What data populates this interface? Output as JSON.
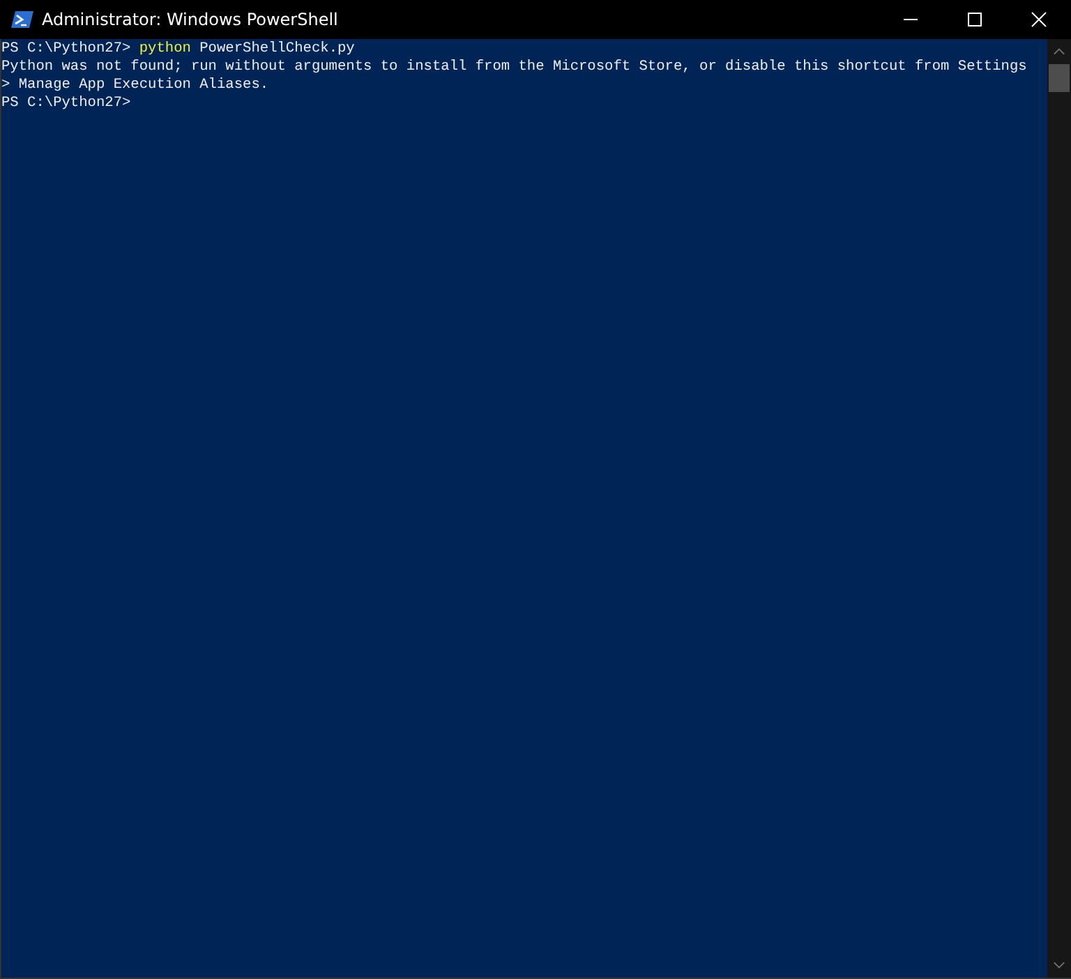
{
  "window": {
    "title": "Administrator: Windows PowerShell"
  },
  "console": {
    "lines": [
      {
        "segments": [
          {
            "text": "PS C:\\Python27> ",
            "kind": "plain"
          },
          {
            "text": "python",
            "kind": "command"
          },
          {
            "text": " PowerShellCheck.py",
            "kind": "plain"
          }
        ]
      },
      {
        "segments": [
          {
            "text": "Python was not found; run without arguments to install from the Microsoft Store, or disable this shortcut from Settings",
            "kind": "plain"
          }
        ]
      },
      {
        "segments": [
          {
            "text": "> Manage App Execution Aliases.",
            "kind": "plain"
          }
        ]
      },
      {
        "segments": [
          {
            "text": "PS C:\\Python27>",
            "kind": "plain"
          }
        ]
      }
    ]
  }
}
